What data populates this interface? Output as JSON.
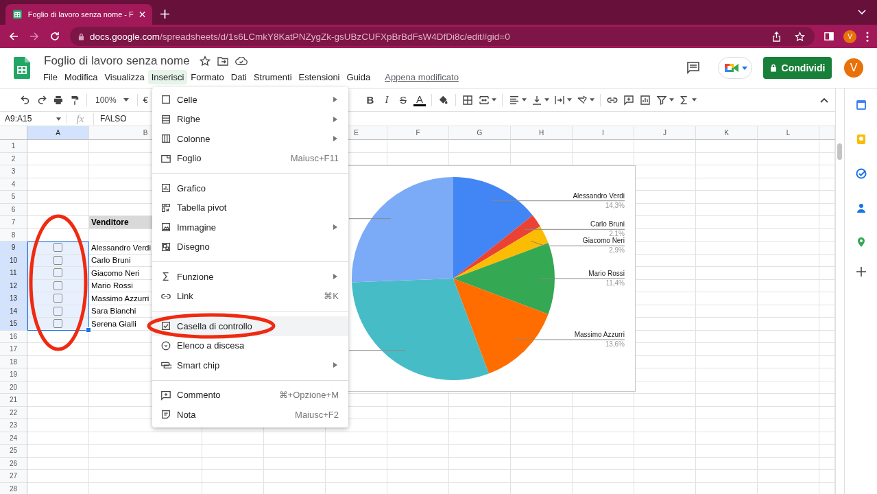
{
  "browser": {
    "tab": {
      "title": "Foglio di lavoro senza nome - F",
      "selected": true
    },
    "url": {
      "host": "docs.google.com",
      "path": "/spreadsheets/d/1s6LCmkY8KatPNZygZk-gsUBzCUFXpBrBdFsW4DfDi8c/edit#gid=0"
    },
    "profile": "V"
  },
  "document": {
    "title": "Foglio di lavoro senza nome",
    "status": "Appena modificato",
    "share": "Condividi",
    "avatar": "V"
  },
  "menu_bar": [
    {
      "label": "File",
      "selected": false
    },
    {
      "label": "Modifica",
      "selected": false
    },
    {
      "label": "Visualizza",
      "selected": false
    },
    {
      "label": "Inserisci",
      "selected": true
    },
    {
      "label": "Formato",
      "selected": false
    },
    {
      "label": "Dati",
      "selected": false
    },
    {
      "label": "Strumenti",
      "selected": false
    },
    {
      "label": "Estensioni",
      "selected": false
    },
    {
      "label": "Guida",
      "selected": false
    }
  ],
  "toolbar": {
    "zoom": "100%",
    "currency": "€",
    "text_format": [
      "B",
      "I",
      "S",
      "A"
    ]
  },
  "formula_bar": {
    "name_box": "A9:A15",
    "fx": "fx",
    "value": "FALSO"
  },
  "sheet": {
    "columns": [
      {
        "label": "A",
        "selected": true
      },
      {
        "label": "B",
        "selected": false
      },
      null,
      null,
      {
        "label": "E",
        "selected": false
      },
      {
        "label": "F",
        "selected": false
      },
      {
        "label": "G",
        "selected": false
      },
      {
        "label": "H",
        "selected": false
      },
      {
        "label": "I",
        "selected": false
      },
      {
        "label": "J",
        "selected": false
      },
      {
        "label": "K",
        "selected": false
      },
      {
        "label": "L",
        "selected": false
      }
    ],
    "rows": [
      {
        "label": "1",
        "selected": false
      },
      {
        "label": "2",
        "selected": false
      },
      {
        "label": "3",
        "selected": false
      },
      {
        "label": "4",
        "selected": false
      },
      {
        "label": "5",
        "selected": false
      },
      {
        "label": "6",
        "selected": false
      },
      {
        "label": "7",
        "selected": false,
        "cells": [
          null,
          {
            "kind": "header",
            "text": "Venditore"
          }
        ]
      },
      {
        "label": "8",
        "selected": false
      },
      {
        "label": "9",
        "selected": true,
        "cells": [
          {
            "kind": "checkbox",
            "checked": false,
            "selected": true
          },
          {
            "kind": "text",
            "text": "Alessandro Verdi"
          }
        ]
      },
      {
        "label": "10",
        "selected": true,
        "cells": [
          {
            "kind": "checkbox",
            "checked": false,
            "selected": true
          },
          {
            "kind": "text",
            "text": "Carlo Bruni"
          }
        ]
      },
      {
        "label": "11",
        "selected": true,
        "cells": [
          {
            "kind": "checkbox",
            "checked": false,
            "selected": true
          },
          {
            "kind": "text",
            "text": "Giacomo Neri"
          }
        ]
      },
      {
        "label": "12",
        "selected": true,
        "cells": [
          {
            "kind": "checkbox",
            "checked": false,
            "selected": true
          },
          {
            "kind": "text",
            "text": "Mario Rossi"
          }
        ]
      },
      {
        "label": "13",
        "selected": true,
        "cells": [
          {
            "kind": "checkbox",
            "checked": false,
            "selected": true
          },
          {
            "kind": "text",
            "text": "Massimo Azzurri"
          }
        ]
      },
      {
        "label": "14",
        "selected": true,
        "cells": [
          {
            "kind": "checkbox",
            "checked": false,
            "selected": true
          },
          {
            "kind": "text",
            "text": "Sara Bianchi"
          }
        ]
      },
      {
        "label": "15",
        "selected": true,
        "cells": [
          {
            "kind": "checkbox",
            "checked": false,
            "selected": true
          },
          {
            "kind": "text",
            "text": "Serena Gialli"
          }
        ]
      },
      {
        "label": "16",
        "selected": false
      },
      {
        "label": "17",
        "selected": false
      },
      {
        "label": "18",
        "selected": false
      },
      {
        "label": "19",
        "selected": false
      },
      {
        "label": "20",
        "selected": false
      },
      {
        "label": "21",
        "selected": false
      },
      {
        "label": "22",
        "selected": false
      },
      {
        "label": "23",
        "selected": false
      },
      {
        "label": "24",
        "selected": false
      },
      {
        "label": "25",
        "selected": false
      },
      {
        "label": "26",
        "selected": false
      },
      {
        "label": "27",
        "selected": false
      },
      {
        "label": "28",
        "selected": false
      }
    ]
  },
  "chart": {
    "chart_data": {
      "type": "pie",
      "categories": [
        "Alessandro Verdi",
        "Carlo Bruni",
        "Giacomo Neri",
        "Mario Rossi",
        "Massimo Azzurri",
        null,
        null
      ],
      "values": [
        14.3,
        2.1,
        2.9,
        11.4,
        13.6,
        30.1,
        25.6
      ],
      "value_labels": [
        "14,3%",
        "2,1%",
        "2,9%",
        "11,4%",
        "13,6%",
        null,
        null
      ]
    }
  },
  "insert_menu": {
    "groups": [
      [
        {
          "label": "Celle",
          "submenu": true,
          "selected": false
        },
        {
          "label": "Righe",
          "submenu": true,
          "selected": false
        },
        {
          "label": "Colonne",
          "submenu": true,
          "selected": false
        },
        {
          "label": "Foglio",
          "shortcut": "Maiusc+F11",
          "submenu": false,
          "selected": false
        }
      ],
      [
        {
          "label": "Grafico",
          "submenu": false,
          "selected": false
        },
        {
          "label": "Tabella pivot",
          "submenu": false,
          "selected": false
        },
        {
          "label": "Immagine",
          "submenu": true,
          "selected": false
        },
        {
          "label": "Disegno",
          "submenu": false,
          "selected": false
        }
      ],
      [
        {
          "label": "Funzione",
          "submenu": true,
          "selected": false
        },
        {
          "label": "Link",
          "shortcut": "⌘K",
          "submenu": false,
          "selected": false
        }
      ],
      [
        {
          "label": "Casella di controllo",
          "submenu": false,
          "selected": true
        },
        {
          "label": "Elenco a discesa",
          "submenu": false,
          "selected": false
        },
        {
          "label": "Smart chip",
          "submenu": true,
          "selected": false
        }
      ],
      [
        {
          "label": "Commento",
          "shortcut": "⌘+Opzione+M",
          "submenu": false,
          "selected": false
        },
        {
          "label": "Nota",
          "shortcut": "Maiusc+F2",
          "submenu": false,
          "selected": false
        }
      ]
    ]
  }
}
